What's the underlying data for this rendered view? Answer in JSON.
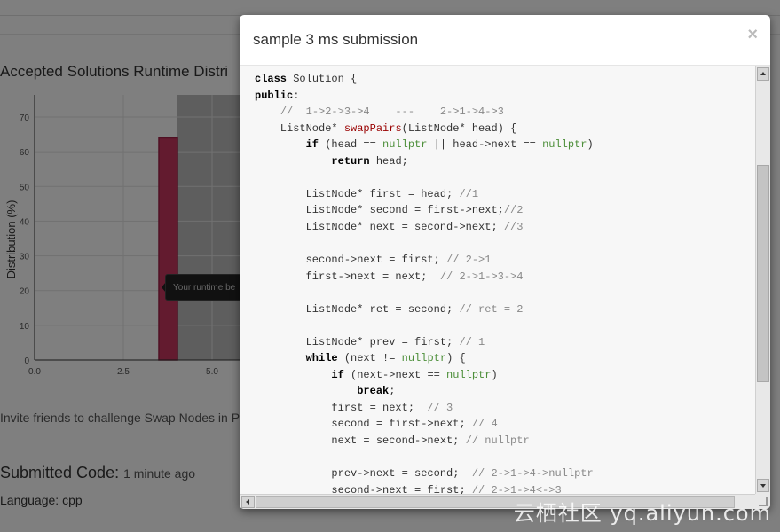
{
  "page": {
    "chart_title": "Accepted Solutions Runtime Distri",
    "invite_text": "Invite friends to challenge Swap Nodes in P",
    "submitted_label": "Submitted Code:",
    "submitted_time": "1 minute ago",
    "language": "Language: cpp",
    "tooltip": "Your runtime be"
  },
  "chart_data": {
    "type": "bar",
    "ylabel": "Distribution (%)",
    "y_ticks": [
      "0",
      "10",
      "20",
      "30",
      "40",
      "50",
      "60",
      "70"
    ],
    "x_ticks": [
      "0.0",
      "2.5",
      "5.0"
    ],
    "ylim": [
      0,
      75
    ],
    "xlim": [
      0,
      5.8
    ],
    "bars": [
      {
        "x0": 3.0,
        "x1": 4.0,
        "value": 64
      }
    ],
    "highlight_range": [
      4.0,
      5.8
    ],
    "colors": {
      "bar_fill": "#c6365f",
      "bar_stroke": "#9e2147",
      "highlight": "#bdbdbd"
    }
  },
  "modal": {
    "title": "sample 3 ms submission",
    "close_symbol": "×"
  },
  "watermark": "云栖社区 yq.aliyun.com"
}
